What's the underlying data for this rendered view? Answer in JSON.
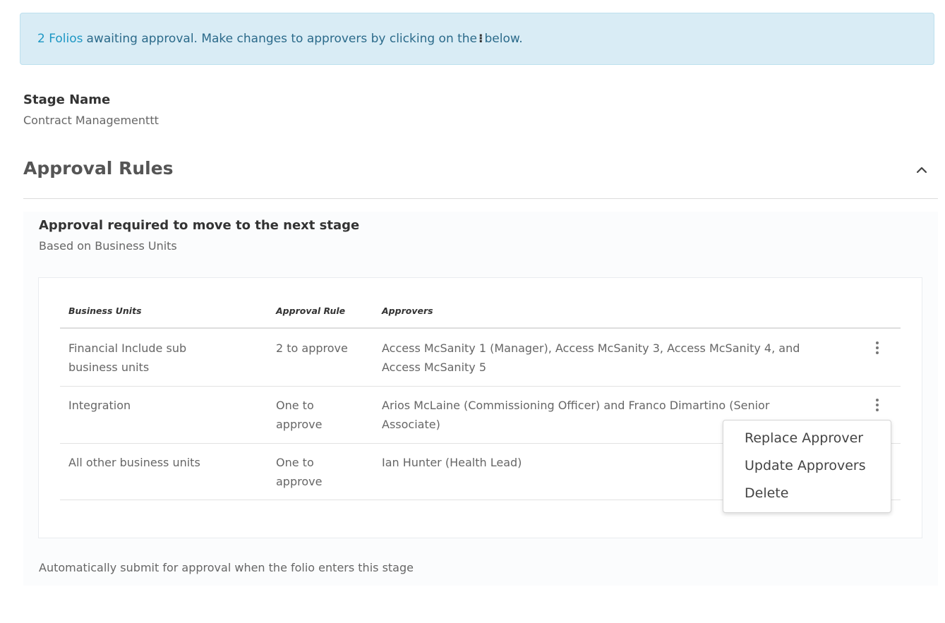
{
  "alert": {
    "link_text": "2 Folios",
    "message_before_icon": "awaiting approval. Make changes to approvers by clicking on the",
    "icon": "kebab-icon",
    "message_after_icon": "below.",
    "icon_glyph": "⁝"
  },
  "stage": {
    "label": "Stage Name",
    "value": "Contract Managementtt"
  },
  "section": {
    "title": "Approval Rules",
    "collapse_icon": "chevron-up-icon"
  },
  "requirement": {
    "title": "Approval required to move to the next stage",
    "subtitle": "Based on Business Units"
  },
  "table": {
    "headers": [
      "Business Units",
      "Approval Rule",
      "Approvers"
    ],
    "rows": [
      {
        "unit_line1": "Financial Include sub",
        "unit_line2": "business units",
        "rule_line1": "2 to approve",
        "rule_line2": "",
        "approvers_line1": "Access McSanity 1 (Manager), Access McSanity 3, Access McSanity 4, and",
        "approvers_line2": "Access McSanity 5"
      },
      {
        "unit_line1": "Integration",
        "unit_line2": "",
        "rule_line1": "One to",
        "rule_line2": "approve",
        "approvers_line1": "Arios McLaine (Commissioning Officer) and Franco Dimartino (Senior",
        "approvers_line2": "Associate)"
      },
      {
        "unit_line1": "All other business units",
        "unit_line2": "",
        "rule_line1": "One to",
        "rule_line2": "approve",
        "approvers_line1": "Ian Hunter (Health Lead)",
        "approvers_line2": ""
      }
    ]
  },
  "context_menu": {
    "items": [
      "Replace Approver",
      "Update Approvers",
      "Delete"
    ]
  },
  "footer": {
    "auto_submit_text": "Automatically submit for approval when the folio enters this stage"
  }
}
